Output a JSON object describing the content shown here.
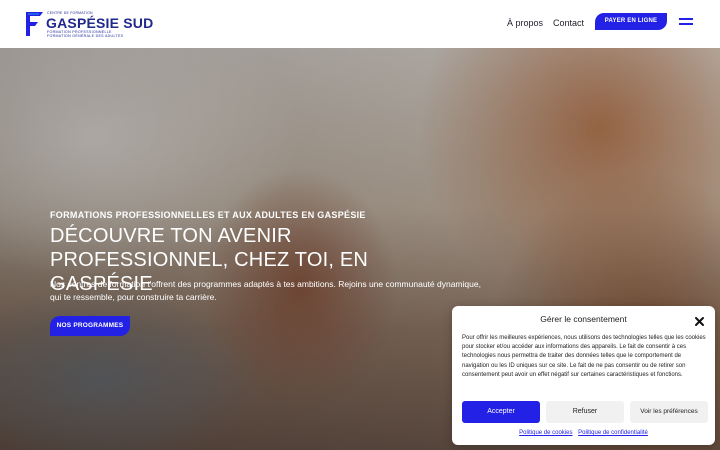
{
  "header": {
    "logo": {
      "small": "CENTRE DE FORMATION",
      "name": "GASPÉSIE SUD",
      "sub1": "FORMATION PROFESSIONNELLE",
      "sub2": "FORMATION GÉNÉRALE DES ADULTES",
      "icon": "logo-f-icon"
    },
    "nav": [
      {
        "label": "À propos"
      },
      {
        "label": "Contact"
      }
    ],
    "pay_button": "PAYER EN LIGNE",
    "menu_icon": "hamburger-menu-icon"
  },
  "hero": {
    "eyebrow": "FORMATIONS PROFESSIONNELLES ET AUX ADULTES EN GASPÉSIE",
    "title": "DÉCOUVRE TON AVENIR PROFESSIONNEL, CHEZ TOI, EN GASPÉSIE",
    "text": "Nos centres de formation t'offrent des programmes adaptés à tes ambitions. Rejoins une communauté dynamique, qui te ressemble, pour construire ta carrière.",
    "button": "NOS PROGRAMMES"
  },
  "consent": {
    "title": "Gérer le consentement",
    "body": "Pour offrir les meilleures expériences, nous utilisons des technologies telles que les cookies pour stocker et/ou accéder aux informations des appareils. Le fait de consentir à ces technologies nous permettra de traiter des données telles que le comportement de navigation ou les ID uniques sur ce site. Le fait de ne pas consentir ou de retirer son consentement peut avoir un effet négatif sur certaines caractéristiques et fonctions.",
    "accept": "Accepter",
    "refuse": "Refuser",
    "preferences": "Voir les préférences",
    "link_cookies": "Politique de cookies",
    "link_privacy": "Politique de confidentialité"
  },
  "colors": {
    "accent": "#2321e6",
    "brand_dark": "#20288c"
  }
}
